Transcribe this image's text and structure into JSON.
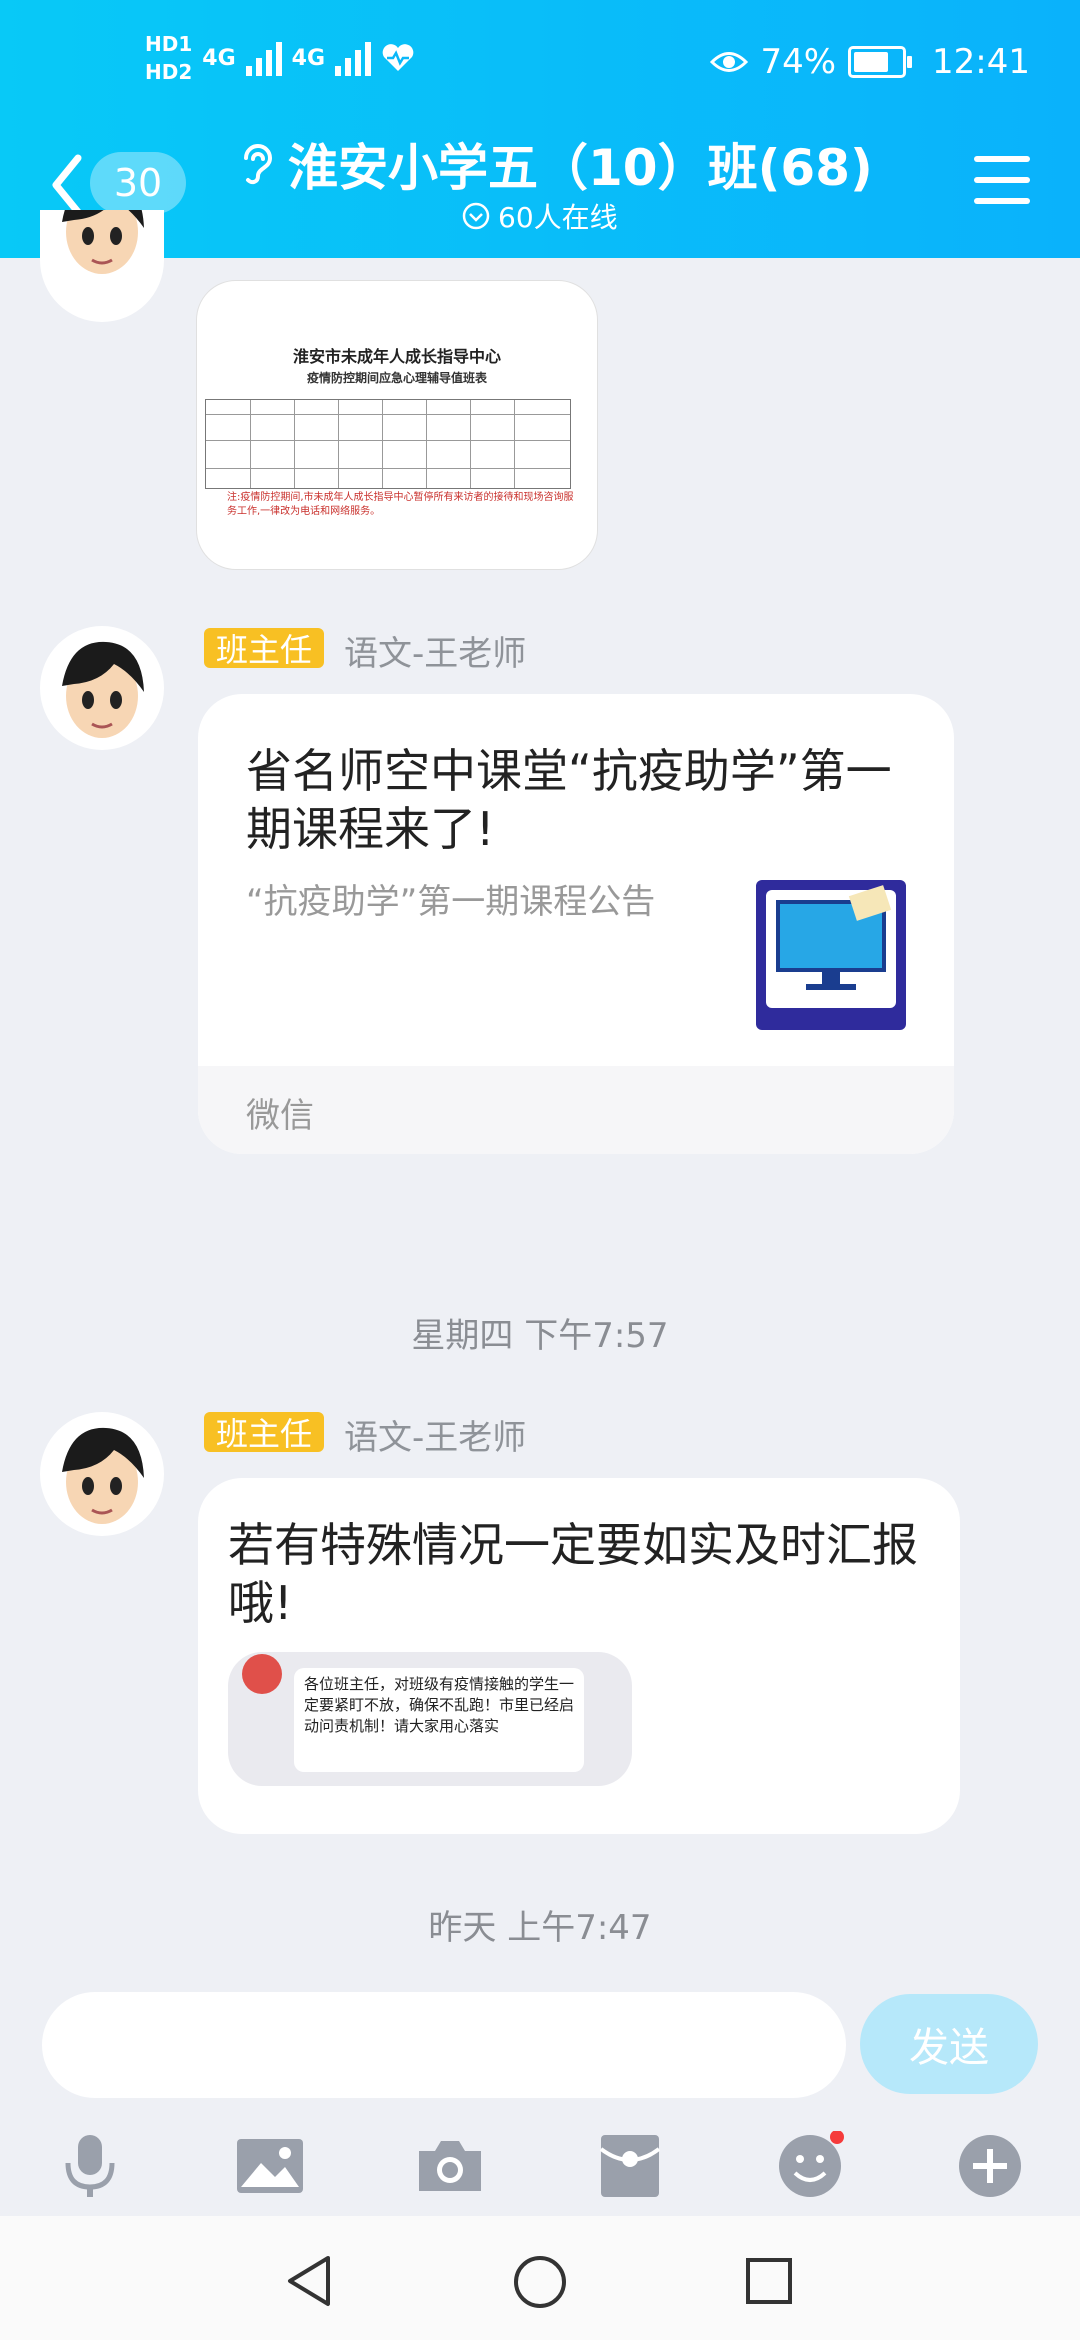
{
  "status_bar": {
    "hd1": "HD1",
    "hd2": "HD2",
    "net1": "4G",
    "net2": "4G",
    "battery_percent": "74%",
    "battery_level": 0.74,
    "time": "12:41"
  },
  "header": {
    "back_badge": "30",
    "title": "淮安小学五（10）班(68)",
    "online": "60人在线",
    "bg_color": "#0ab8f9"
  },
  "messages": {
    "doc_image": {
      "title": "淮安市未成年人成长指导中心",
      "subtitle": "疫情防控期间应急心理辅导值班表",
      "note": "注:疫情防控期间,市未成年人成长指导中心暂停所有来访者的接待和现场咨询服务工作,一律改为电话和网络服务。"
    },
    "msg1": {
      "tag": "班主任",
      "sender": "语文-王老师",
      "card_title": "省名师空中课堂“抗疫助学”第一期课程来了!",
      "card_subtitle": "“抗疫助学”第一期课程公告",
      "card_source": "微信"
    },
    "time1": "星期四 下午7:57",
    "msg2": {
      "tag": "班主任",
      "sender": "语文-王老师",
      "text": "若有特殊情况一定要如实及时汇报哦!",
      "quote": "各位班主任，对班级有疫情接触的学生一定要紧盯不放，确保不乱跑！市里已经启动问责机制！请大家用心落实"
    },
    "time2": "昨天 上午7:47"
  },
  "composer": {
    "send_label": "发送"
  },
  "toolbar": {
    "icons": [
      "microphone-icon",
      "image-icon",
      "camera-icon",
      "red-packet-icon",
      "emoji-icon",
      "plus-icon"
    ]
  },
  "colors": {
    "tag": "#f8c023",
    "accent": "#0ab8f9",
    "send_disabled": "#b6e8fa"
  }
}
